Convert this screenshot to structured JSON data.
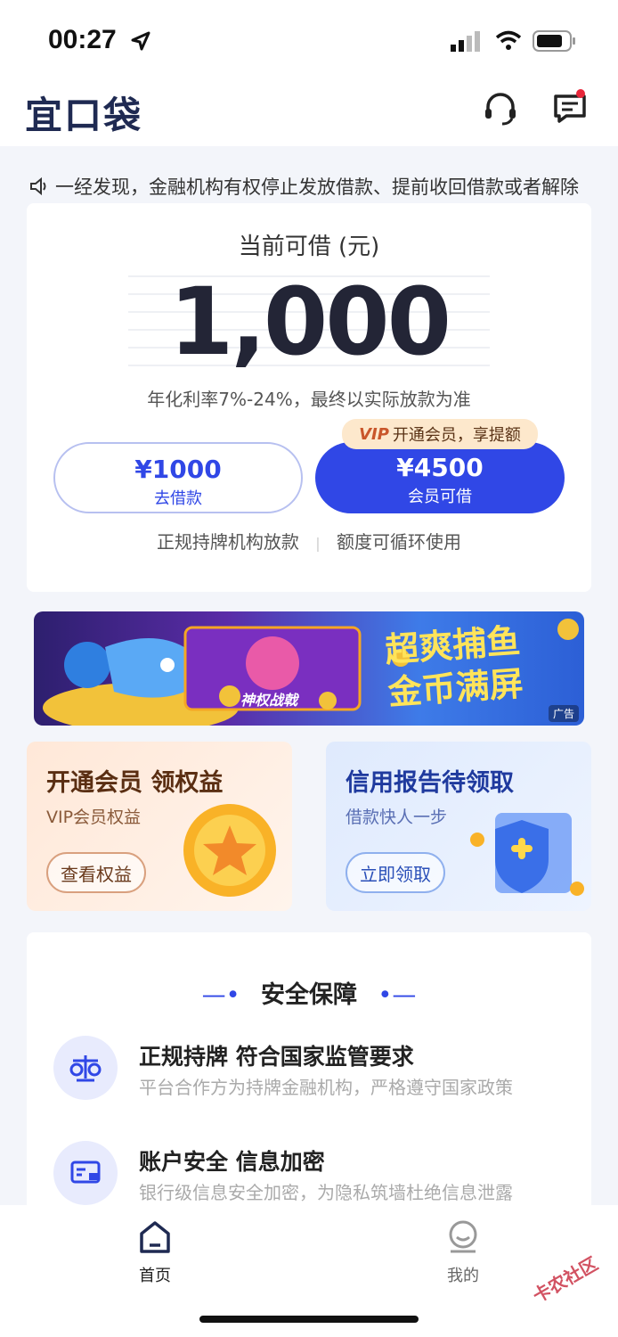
{
  "status_bar": {
    "time": "00:27"
  },
  "header": {
    "logo": "宜口袋"
  },
  "notice": {
    "text": "一经发现，金融机构有权停止发放借款、提前收回借款或者解除"
  },
  "loan": {
    "caption": "当前可借 (元)",
    "amount": "1,000",
    "rate_note": "年化利率7%-24%，最终以实际放款为准",
    "btn_borrow_amount": "¥1000",
    "btn_borrow_label": "去借款",
    "vip_badge_mark": "VIP",
    "vip_badge_text": "开通会员，享提额",
    "btn_member_amount": "¥4500",
    "btn_member_label": "会员可借",
    "footer_left": "正规持牌机构放款",
    "footer_right": "额度可循环使用"
  },
  "banner": {
    "slogan_line1": "超爽捕鱼",
    "slogan_line2": "金币满屏",
    "badge_text": "神权战戟",
    "ad_label": "广告"
  },
  "promo": {
    "left": {
      "title": "开通会员 领权益",
      "subtitle": "VIP会员权益",
      "button": "查看权益"
    },
    "right": {
      "title": "信用报告待领取",
      "subtitle": "借款快人一步",
      "button": "立即领取"
    }
  },
  "security": {
    "title": "安全保障",
    "items": [
      {
        "title": "正规持牌 符合国家监管要求",
        "desc": "平台合作方为持牌金融机构，严格遵守国家政策",
        "icon": "scale-icon"
      },
      {
        "title": "账户安全 信息加密",
        "desc": "银行级信息安全加密，为隐私筑墙杜绝信息泄露",
        "icon": "secure-card-icon"
      }
    ]
  },
  "tabbar": {
    "home": "首页",
    "mine": "我的"
  },
  "watermark": {
    "text": "卡农社区"
  },
  "colors": {
    "brand_blue": "#3047e6",
    "logo_navy": "#1f2a52",
    "vip_gold": "#fde8cc"
  }
}
